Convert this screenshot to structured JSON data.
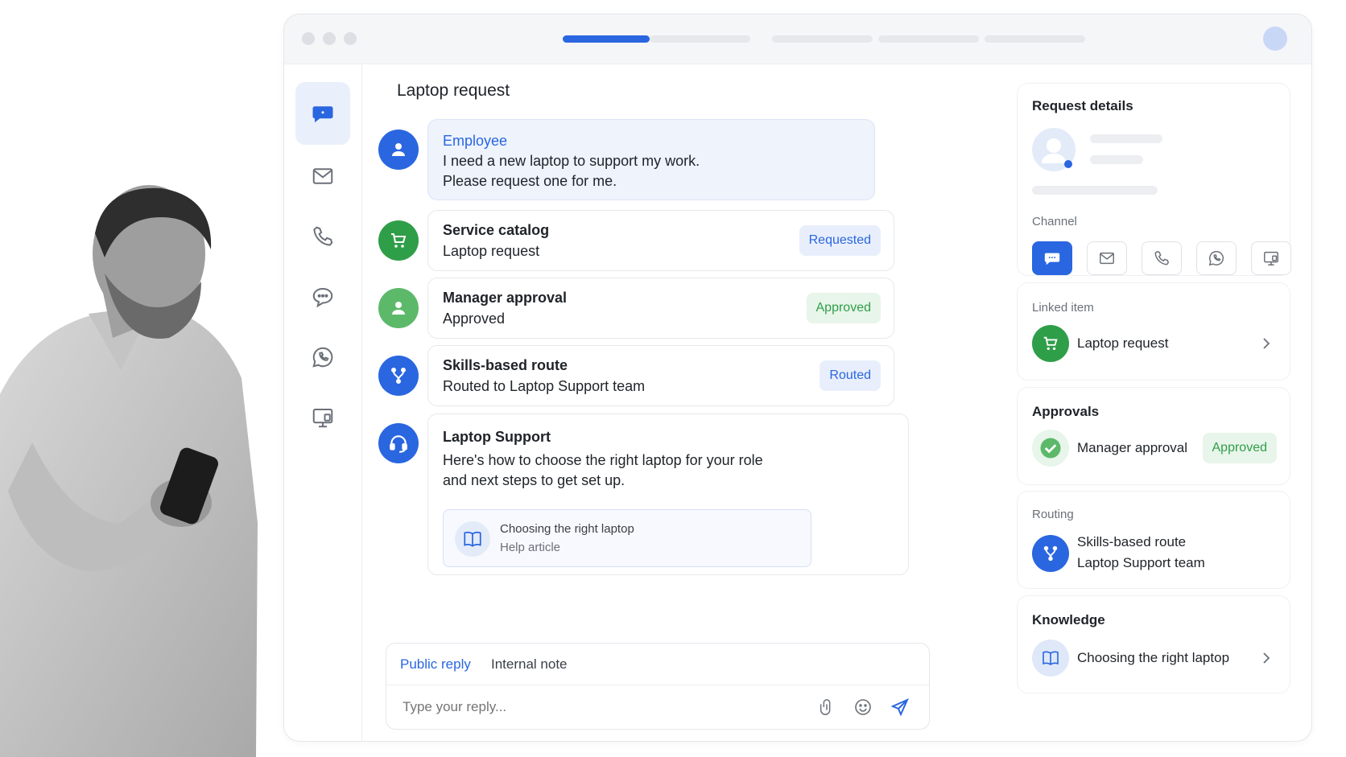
{
  "page_title": "Laptop request",
  "timeline": [
    {
      "title": "Employee",
      "lines": [
        "I need a new laptop to support my work.",
        "Please request one for me."
      ],
      "badge": ""
    },
    {
      "title": "Service catalog",
      "lines": [
        "Laptop request"
      ],
      "badge": "Requested"
    },
    {
      "title": "Manager approval",
      "lines": [
        "Approved"
      ],
      "badge": "Approved"
    },
    {
      "title": "Skills-based route",
      "lines": [
        "Routed to Laptop Support team"
      ],
      "badge": "Routed"
    },
    {
      "title": "Laptop Support",
      "lines": [
        "Here's how to choose the right laptop for your role",
        "and next steps to get set up."
      ],
      "badge": "",
      "article": {
        "title": "Choosing the right laptop",
        "subtitle": "Help article"
      }
    }
  ],
  "reply": {
    "tabs": [
      "Public reply",
      "Internal note"
    ],
    "placeholder": "Type your reply..."
  },
  "details": {
    "title": "Request details",
    "channel_label": "Channel",
    "channels": [
      "chat-icon",
      "mail-icon",
      "phone-icon",
      "whatsapp-icon",
      "screen-icon"
    ]
  },
  "linked": {
    "label": "Linked item",
    "item": "Laptop request"
  },
  "approvals": {
    "title": "Approvals",
    "item": "Manager approval",
    "badge": "Approved"
  },
  "routing": {
    "label": "Routing",
    "line1": "Skills-based route",
    "line2": "Laptop Support team"
  },
  "knowledge": {
    "title": "Knowledge",
    "item": "Choosing the right laptop"
  },
  "colors": {
    "accent": "#2a66e0",
    "green": "#2f9e49",
    "light_green": "#5cb96a"
  }
}
